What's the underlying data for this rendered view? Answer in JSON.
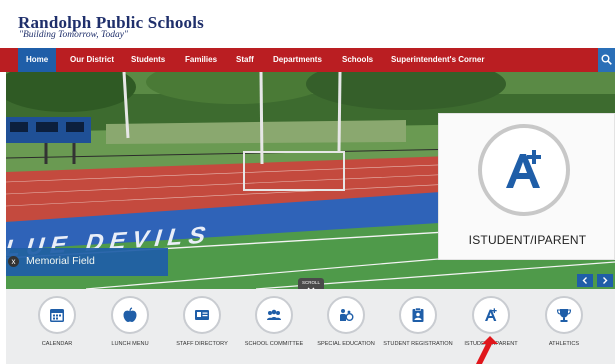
{
  "header": {
    "title": "Randolph Public Schools",
    "tagline": "\"Building Tomorrow, Today\""
  },
  "nav": {
    "items": [
      "Home",
      "Our District",
      "Students",
      "Families",
      "Staff",
      "Departments",
      "Schools",
      "Superintendent's Corner"
    ],
    "active": "Home",
    "search_icon": "search-icon"
  },
  "hero": {
    "field_text": "BLUE DEVILS",
    "caption": "Memorial Field",
    "close_glyph": "x",
    "scroll_label": "SCROLL",
    "prev_glyph": "‹",
    "next_glyph": "›"
  },
  "zoom_inset": {
    "label": "ISTUDENT/IPARENT",
    "icon": "a-plus-icon"
  },
  "quick_links": [
    {
      "label": "CALENDAR",
      "icon": "calendar-icon"
    },
    {
      "label": "LUNCH MENU",
      "icon": "apple-icon"
    },
    {
      "label": "STAFF DIRECTORY",
      "icon": "id-card-icon"
    },
    {
      "label": "SCHOOL COMMITTEE",
      "icon": "people-icon"
    },
    {
      "label": "SPECIAL EDUCATION",
      "icon": "special-education-icon"
    },
    {
      "label": "STUDENT REGISTRATION",
      "icon": "clipboard-icon"
    },
    {
      "label": "ISTUDENT/IPARENT",
      "icon": "a-plus-icon"
    },
    {
      "label": "ATHLETICS",
      "icon": "trophy-icon"
    }
  ],
  "colors": {
    "nav_red": "#ba1e22",
    "accent_blue": "#1f5ea8",
    "title_navy": "#1f2f6b",
    "quick_bg": "#ecedee"
  }
}
